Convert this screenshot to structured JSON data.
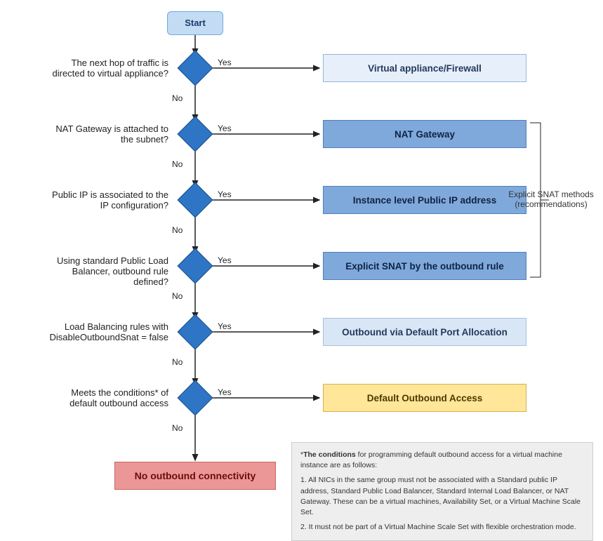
{
  "start": {
    "label": "Start"
  },
  "decisions": [
    {
      "question": "The next hop of traffic is directed to virtual appliance?",
      "yes": "Yes",
      "no": "No"
    },
    {
      "question": "NAT Gateway is attached to the subnet?",
      "yes": "Yes",
      "no": "No"
    },
    {
      "question": "Public IP is associated to the IP configuration?",
      "yes": "Yes",
      "no": "No"
    },
    {
      "question": "Using standard Public Load Balancer, outbound rule defined?",
      "yes": "Yes",
      "no": "No"
    },
    {
      "question": "Load Balancing rules with DisableOutboundSnat = false",
      "yes": "Yes",
      "no": "No"
    },
    {
      "question": "Meets the conditions* of default outbound access",
      "yes": "Yes",
      "no": "No"
    }
  ],
  "results": [
    {
      "label": "Virtual appliance/Firewall",
      "style": "rb-light"
    },
    {
      "label": "NAT Gateway",
      "style": "rb-blue"
    },
    {
      "label": "Instance level Public IP address",
      "style": "rb-blue"
    },
    {
      "label": "Explicit SNAT by the outbound rule",
      "style": "rb-blue"
    },
    {
      "label": "Outbound via Default Port Allocation",
      "style": "rb-verylight"
    },
    {
      "label": "Default Outbound Access",
      "style": "rb-yellow"
    }
  ],
  "terminal": {
    "label": "No outbound connectivity"
  },
  "bracket": {
    "line1": "Explicit SNAT methods",
    "line2": "(recommendations)"
  },
  "footnote": {
    "title_prefix": "*",
    "title_bold": "The conditions",
    "title_rest": " for programming default outbound access for a virtual machine instance are as follows:",
    "item1": "1. All NICs in the same group must not be associated with a Standard public IP address, Standard Public Load Balancer, Standard Internal Load Balancer, or NAT Gateway. These can be a virtual machines, Availability Set, or a Virtual Machine Scale Set.",
    "item2": "2. It must not be part of a Virtual Machine Scale Set with flexible orchestration mode."
  }
}
